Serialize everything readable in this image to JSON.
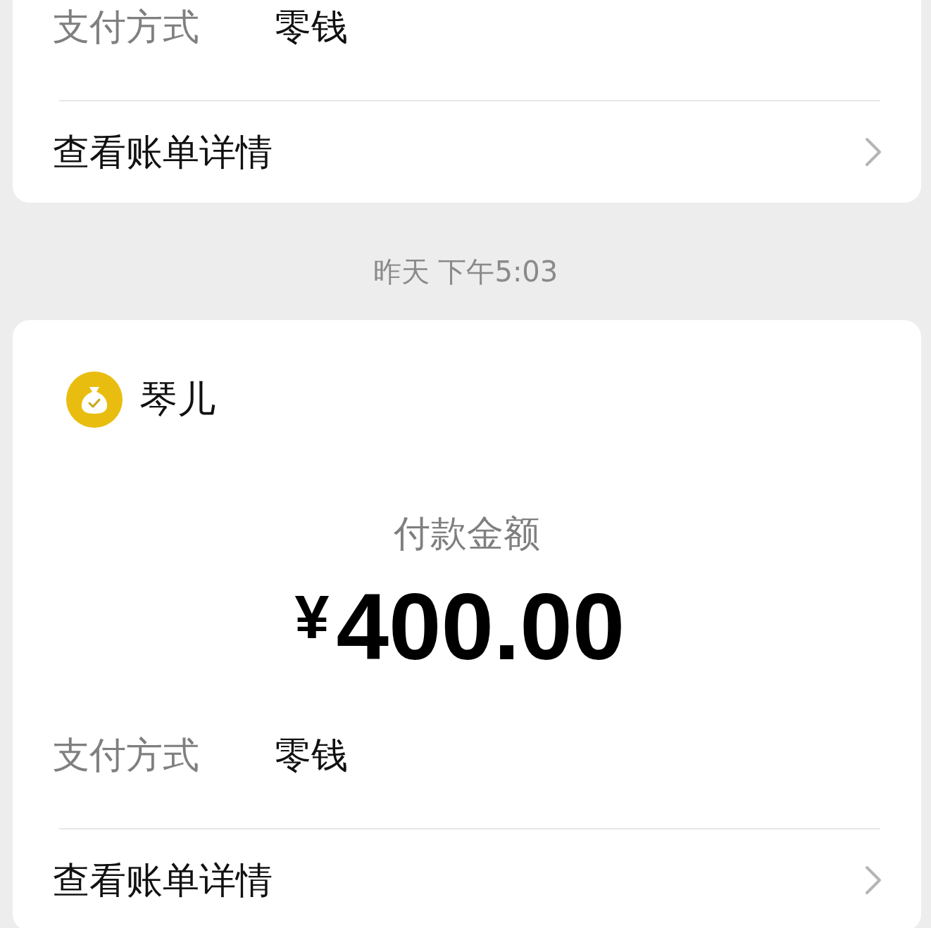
{
  "records": [
    {
      "payment_method": {
        "label": "支付方式",
        "value": "零钱"
      },
      "details_link": {
        "label": "查看账单详情"
      }
    },
    {
      "timestamp": "昨天 下午5:03",
      "payee": {
        "name": "琴儿"
      },
      "amount": {
        "label": "付款金额",
        "currency": "¥",
        "value": "400.00"
      },
      "payment_method": {
        "label": "支付方式",
        "value": "零钱"
      },
      "details_link": {
        "label": "查看账单详情"
      }
    }
  ]
}
